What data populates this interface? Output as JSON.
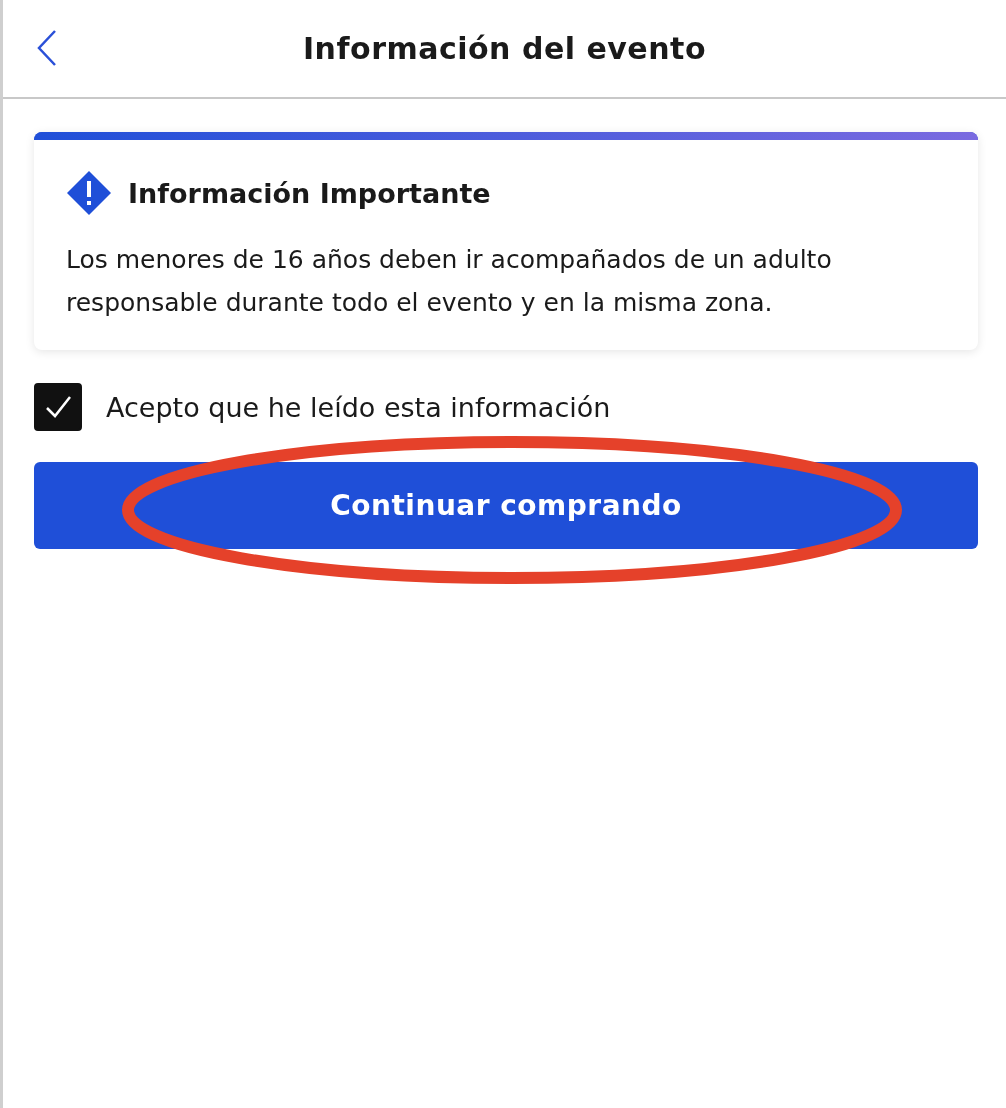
{
  "header": {
    "title": "Información del evento"
  },
  "notice": {
    "title": "Información Importante",
    "text": "Los menores de 16 años deben ir acompañados de un adulto responsable durante todo el evento y en la misma zona."
  },
  "consent": {
    "label": "Acepto que he leído esta información",
    "checked": true
  },
  "primary_button": {
    "label": "Continuar comprando"
  },
  "annotation": {
    "kind": "ellipse"
  }
}
